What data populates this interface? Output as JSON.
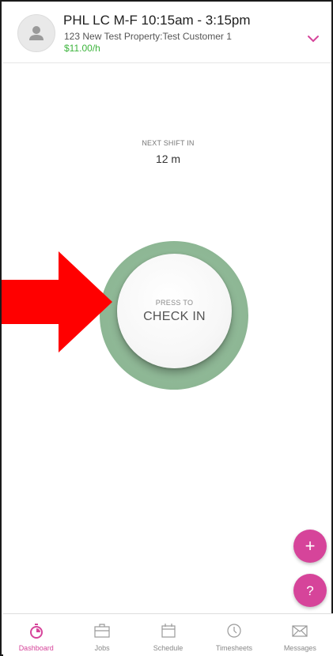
{
  "header": {
    "shift_title": "PHL LC M-F 10:15am - 3:15pm",
    "location": "123 New Test Property:Test Customer 1",
    "rate": "$11.00/h",
    "expand_icon": "chevron-down-icon"
  },
  "next_shift": {
    "label": "NEXT SHIFT IN",
    "value": "12 m"
  },
  "check_in": {
    "hint": "PRESS TO",
    "label": "CHECK IN"
  },
  "fabs": {
    "add_label": "+",
    "help_label": "?"
  },
  "nav": {
    "items": [
      {
        "label": "Dashboard",
        "icon": "stopwatch-icon",
        "active": true
      },
      {
        "label": "Jobs",
        "icon": "briefcase-icon",
        "active": false
      },
      {
        "label": "Schedule",
        "icon": "calendar-icon",
        "active": false
      },
      {
        "label": "Timesheets",
        "icon": "clock-icon",
        "active": false
      },
      {
        "label": "Messages",
        "icon": "envelope-icon",
        "active": false
      }
    ]
  },
  "colors": {
    "accent": "#d6449a",
    "rate": "#3cb43c",
    "ring": "#8fb896",
    "annotation_arrow": "#ff0000"
  }
}
